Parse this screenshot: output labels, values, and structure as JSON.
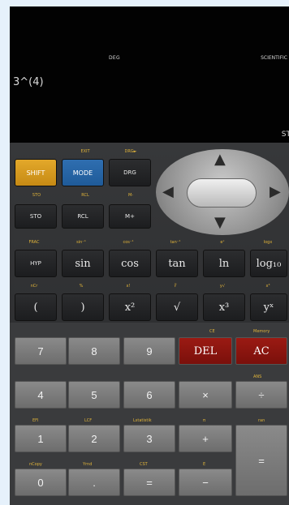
{
  "display": {
    "angle_mode": "DEG",
    "calc_mode": "SCIENTIFIC",
    "expression": "3^(4)",
    "stat_indicator": "ST"
  },
  "row1": {
    "shift": "SHIFT",
    "mode": "MODE",
    "drg": "DRG",
    "labels": [
      "EXIT",
      "DRG►"
    ]
  },
  "row2": {
    "labels": [
      "STO",
      "RCL",
      "M-"
    ],
    "keys": [
      "STO",
      "RCL",
      "M+"
    ]
  },
  "row3": {
    "labels": [
      "FRAC",
      "sin⁻¹",
      "cos⁻¹",
      "tan⁻¹",
      "eˣ",
      "logx"
    ],
    "keys": [
      "HYP",
      "sin",
      "cos",
      "tan",
      "ln",
      "log₁₀"
    ]
  },
  "row4": {
    "labels": [
      "nCr",
      "%",
      "x!",
      "∛",
      "y√",
      "x³"
    ],
    "keys": [
      "(",
      ")",
      "x²",
      "√",
      "x³",
      "yˣ"
    ]
  },
  "top_right_labels": [
    "CE",
    "Memory"
  ],
  "numpad": {
    "row1": [
      "7",
      "8",
      "9",
      "DEL",
      "AC"
    ],
    "row2": [
      "4",
      "5",
      "6",
      "×",
      "÷"
    ],
    "row3": [
      "1",
      "2",
      "3",
      "+"
    ],
    "row4": [
      "0",
      ".",
      "=",
      "−"
    ],
    "enter": "="
  },
  "numpad_labels": {
    "r2_right": "ANS",
    "r3": [
      "EFI",
      "LCF",
      "Lstatistik",
      "π",
      "ran"
    ],
    "r4": [
      "nCopy",
      "Yrnd",
      "CST",
      "E"
    ]
  }
}
